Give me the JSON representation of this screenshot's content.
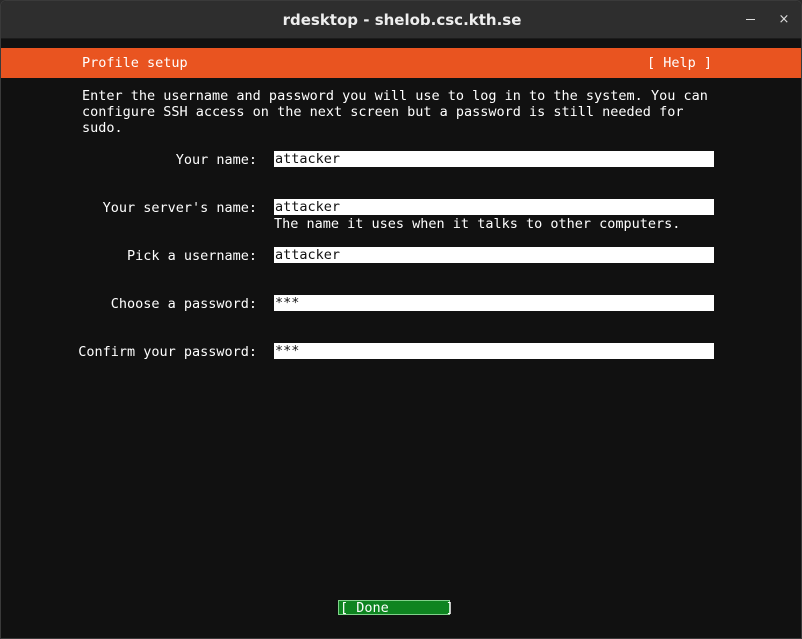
{
  "window": {
    "title": "rdesktop - shelob.csc.kth.se",
    "close_glyph": "×"
  },
  "header": {
    "title": "Profile setup",
    "help": "[ Help ]"
  },
  "intro": {
    "lines": [
      "Enter the username and password you will use to log in to the system. You can",
      "configure SSH access on the next screen but a password is still needed for",
      "sudo."
    ]
  },
  "form": {
    "name_label": "Your name:",
    "name_value": "attacker",
    "server_label": "Your server's name:",
    "server_value": "attacker",
    "server_hint": "The name it uses when it talks to other computers.",
    "username_label": "Pick a username:",
    "username_value": "attacker",
    "password_label": "Choose a password:",
    "password_value": "***",
    "confirm_label": "Confirm your password:",
    "confirm_value": "***"
  },
  "actions": {
    "done_label": "[ Done       ]"
  },
  "colors": {
    "accent": "#e95420",
    "done_button": "#0e8420",
    "background": "#111111"
  }
}
